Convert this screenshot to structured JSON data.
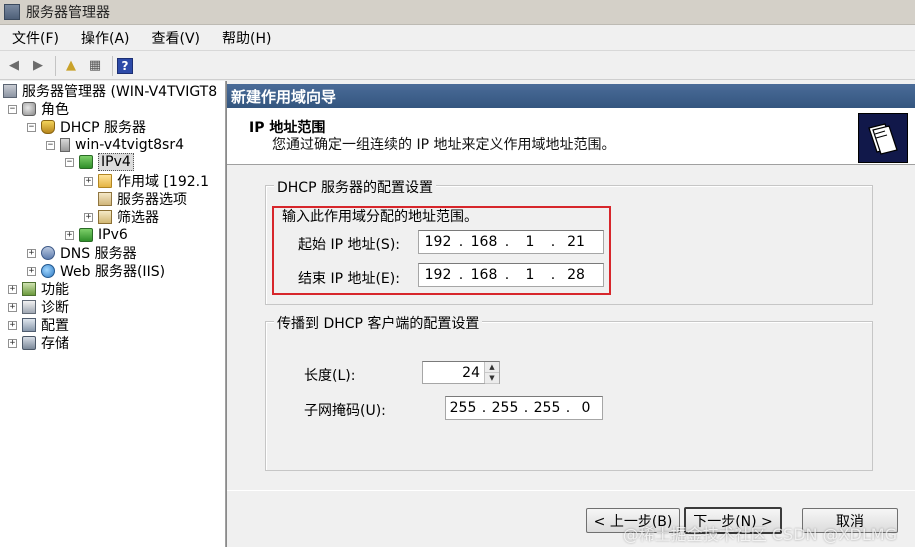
{
  "window": {
    "title": "服务器管理器"
  },
  "menu": {
    "items": [
      "文件(F)",
      "操作(A)",
      "查看(V)",
      "帮助(H)"
    ]
  },
  "tree": {
    "root": "服务器管理器 (WIN-V4TVIGT8",
    "roles": "角色",
    "dhcp": "DHCP 服务器",
    "host": "win-v4tvigt8sr4",
    "ipv4": "IPv4",
    "scope": "作用域 [192.1",
    "server_options": "服务器选项",
    "filters": "筛选器",
    "ipv6": "IPv6",
    "dns": "DNS 服务器",
    "web": "Web 服务器(IIS)",
    "features": "功能",
    "diagnostics": "诊断",
    "configuration": "配置",
    "storage": "存储"
  },
  "wizard": {
    "title": "新建作用域向导",
    "header_title": "IP 地址范围",
    "header_subtitle": "您通过确定一组连续的 IP 地址来定义作用域地址范围。",
    "group1_title": "DHCP 服务器的配置设置",
    "group1_prompt": "输入此作用域分配的地址范围。",
    "start_label": "起始 IP 地址(S):",
    "start_ip": [
      "192",
      "168",
      "1",
      "21"
    ],
    "end_label": "结束 IP 地址(E):",
    "end_ip": [
      "192",
      "168",
      "1",
      "28"
    ],
    "group2_title": "传播到 DHCP 客户端的配置设置",
    "length_label": "长度(L):",
    "length_value": "24",
    "mask_label": "子网掩码(U):",
    "mask": [
      "255",
      "255",
      "255",
      "0"
    ],
    "back_button": "< 上一步(B)",
    "next_button": "下一步(N) >",
    "cancel_button": "取消"
  },
  "watermark": "@稀土掘金技术社区 CSDN @XDLMG"
}
